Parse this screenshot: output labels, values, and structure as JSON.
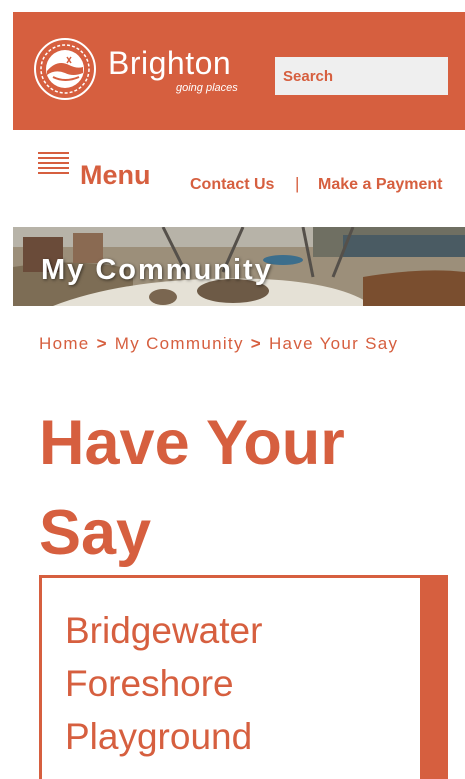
{
  "header": {
    "brand_name": "Brighton",
    "tagline": "going places",
    "seal_text": "BRIGHTON COUNCIL",
    "search_placeholder": "Search",
    "brand_color": "#d65f3f"
  },
  "nav": {
    "menu_label": "Menu",
    "contact_label": "Contact Us",
    "separator": "|",
    "payment_label": "Make a Payment"
  },
  "banner": {
    "title": "My Community"
  },
  "breadcrumb": {
    "items": [
      "Home",
      "My Community",
      "Have Your Say"
    ],
    "separator": ">"
  },
  "page": {
    "title": "Have Your Say"
  },
  "card": {
    "title": "Bridgewater Foreshore Playground"
  }
}
